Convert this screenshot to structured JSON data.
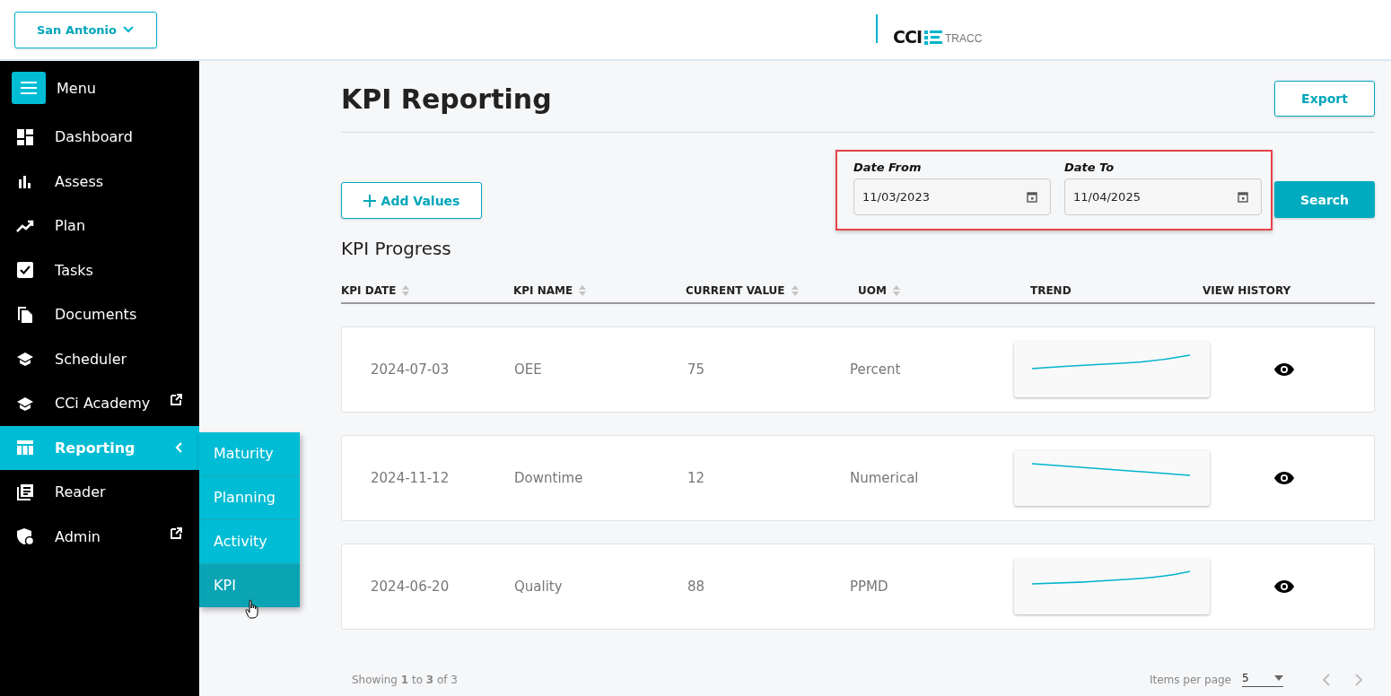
{
  "site_selector": {
    "label": "San Antonio"
  },
  "logo": {
    "brand": "CCI",
    "product": "TRACC"
  },
  "sidebar": {
    "menu_label": "Menu",
    "items": [
      {
        "label": "Dashboard",
        "external": false,
        "selected": false
      },
      {
        "label": "Assess",
        "external": false,
        "selected": false
      },
      {
        "label": "Plan",
        "external": false,
        "selected": false
      },
      {
        "label": "Tasks",
        "external": false,
        "selected": false
      },
      {
        "label": "Documents",
        "external": false,
        "selected": false
      },
      {
        "label": "Scheduler",
        "external": false,
        "selected": false
      },
      {
        "label": "CCi Academy",
        "external": true,
        "selected": false
      },
      {
        "label": "Reporting",
        "external": false,
        "selected": true,
        "expanded": true
      },
      {
        "label": "Reader",
        "external": false,
        "selected": false
      },
      {
        "label": "Admin",
        "external": true,
        "selected": false
      }
    ]
  },
  "submenu": {
    "items": [
      {
        "label": "Maturity",
        "selected": false
      },
      {
        "label": "Planning",
        "selected": false
      },
      {
        "label": "Activity",
        "selected": false
      },
      {
        "label": "KPI",
        "selected": true
      }
    ]
  },
  "page": {
    "title": "KPI Reporting",
    "export_button": "Export",
    "add_button": "Add Values",
    "search_button": "Search"
  },
  "filters": [
    {
      "label": "Date From",
      "value": "11/03/2023"
    },
    {
      "label": "Date To",
      "value": "11/04/2025"
    }
  ],
  "table": {
    "title": "KPI Progress",
    "columns": [
      {
        "label": "KPI DATE",
        "sortable": true
      },
      {
        "label": "KPI NAME",
        "sortable": true
      },
      {
        "label": "CURRENT VALUE",
        "sortable": true
      },
      {
        "label": "UOM",
        "sortable": true
      },
      {
        "label": "TREND",
        "sortable": false
      },
      {
        "label": "VIEW HISTORY",
        "sortable": false
      }
    ],
    "rows": [
      {
        "date": "2024-07-03",
        "name": "OEE",
        "value": "75",
        "uom": "Percent"
      },
      {
        "date": "2024-11-12",
        "name": "Downtime",
        "value": "12",
        "uom": "Numerical"
      },
      {
        "date": "2024-06-20",
        "name": "Quality",
        "value": "88",
        "uom": "PPMD"
      }
    ]
  },
  "footer": {
    "showing": "Showing **1** to **3** of 3",
    "items_per_page_label": "Items per page",
    "items_per_page": "5"
  }
}
